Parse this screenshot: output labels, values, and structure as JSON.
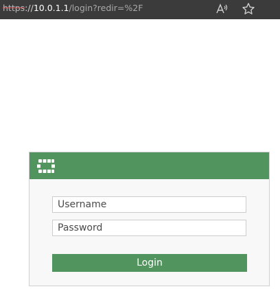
{
  "browser": {
    "url_scheme": "https",
    "url_sep": "://",
    "url_host": "10.0.1.1",
    "url_path": "/login?redir=%2F"
  },
  "icons": {
    "read_aloud": "read-aloud-icon",
    "favorite": "star-icon",
    "logo": "grid-logo-icon"
  },
  "login": {
    "username_placeholder": "Username",
    "password_placeholder": "Password",
    "button_label": "Login"
  },
  "colors": {
    "brand_green": "#51945d",
    "toolbar": "#3b3b3b"
  }
}
